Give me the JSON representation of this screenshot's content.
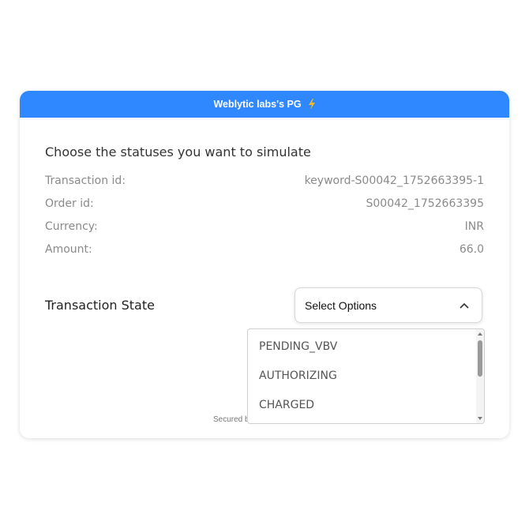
{
  "header": {
    "title": "Weblytic labs's PG",
    "icon": "lightning-bolt-icon",
    "accent_color": "#2f88ff",
    "icon_color": "#f5b91e"
  },
  "main": {
    "title": "Choose the statuses you want to simulate",
    "details": [
      {
        "label": "Transaction id:",
        "value": "keyword-S00042_1752663395-1"
      },
      {
        "label": "Order id:",
        "value": "S00042_1752663395"
      },
      {
        "label": "Currency:",
        "value": "INR"
      },
      {
        "label": "Amount:",
        "value": "66.0"
      }
    ],
    "transaction_state": {
      "label": "Transaction State",
      "select_value": "Select Options",
      "select_icon": "chevron-up-icon",
      "options": [
        "PENDING_VBV",
        "AUTHORIZING",
        "CHARGED"
      ]
    }
  },
  "footer": {
    "text": "Secured b"
  }
}
